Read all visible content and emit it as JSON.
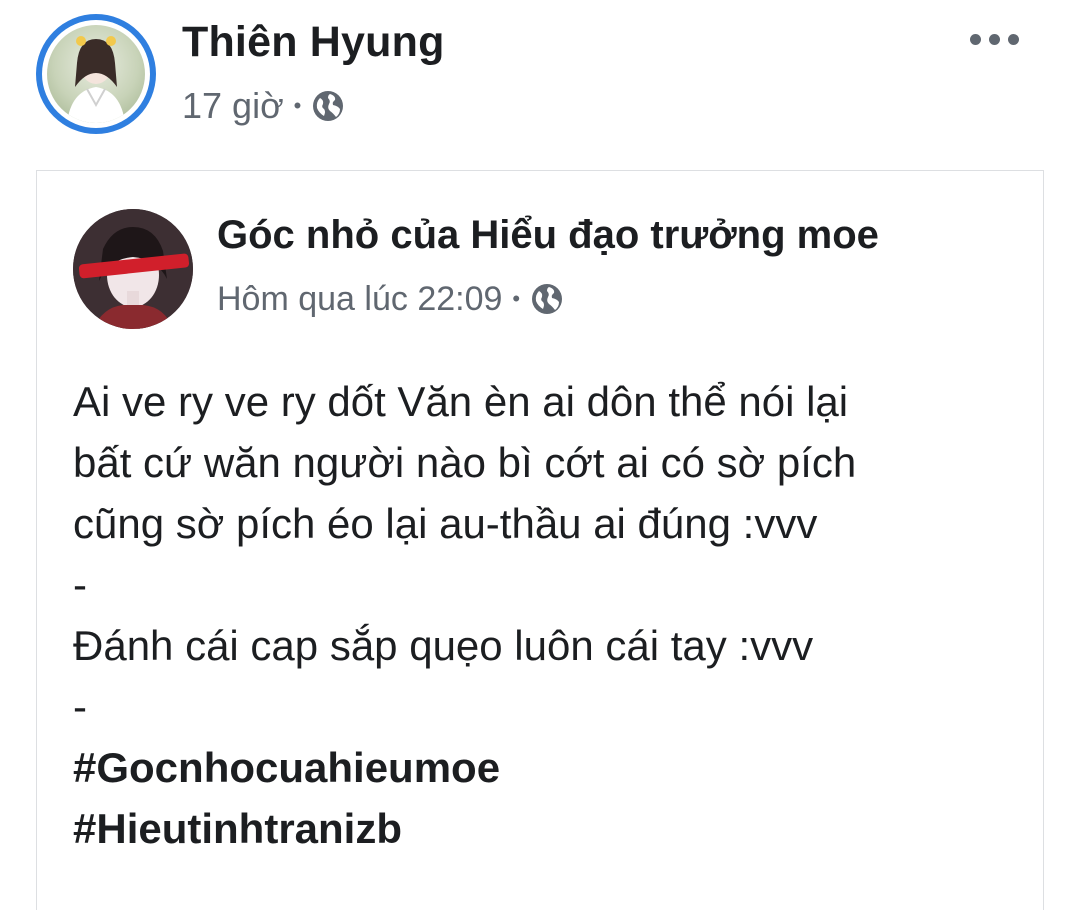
{
  "post": {
    "author": "Thiên Hyung",
    "time": "17 giờ",
    "separator": "•",
    "privacy_icon": "globe-icon",
    "more_icon": "more-options-icon"
  },
  "shared": {
    "page_name": "Góc nhỏ của Hiểu đạo trưởng moe",
    "time": "Hôm qua lúc 22:09",
    "separator": "•",
    "privacy_icon": "globe-icon",
    "lines": [
      "Ai ve ry ve ry dốt Văn èn ai dôn thể nói lại",
      "bất cứ wăn người nào bì cớt ai có sờ pích",
      "cũng sờ pích éo lại au-thầu ai đúng :vvv",
      "-",
      "Đánh cái cap sắp quẹo luôn cái tay :vvv",
      "-"
    ],
    "hashtags": [
      "#Gocnhocuahieumoe",
      "#Hieutinhtranizb"
    ]
  },
  "colors": {
    "text": "#1c1e21",
    "meta": "#606770",
    "ring": "#2f7fe0",
    "border": "#dddfe2"
  }
}
